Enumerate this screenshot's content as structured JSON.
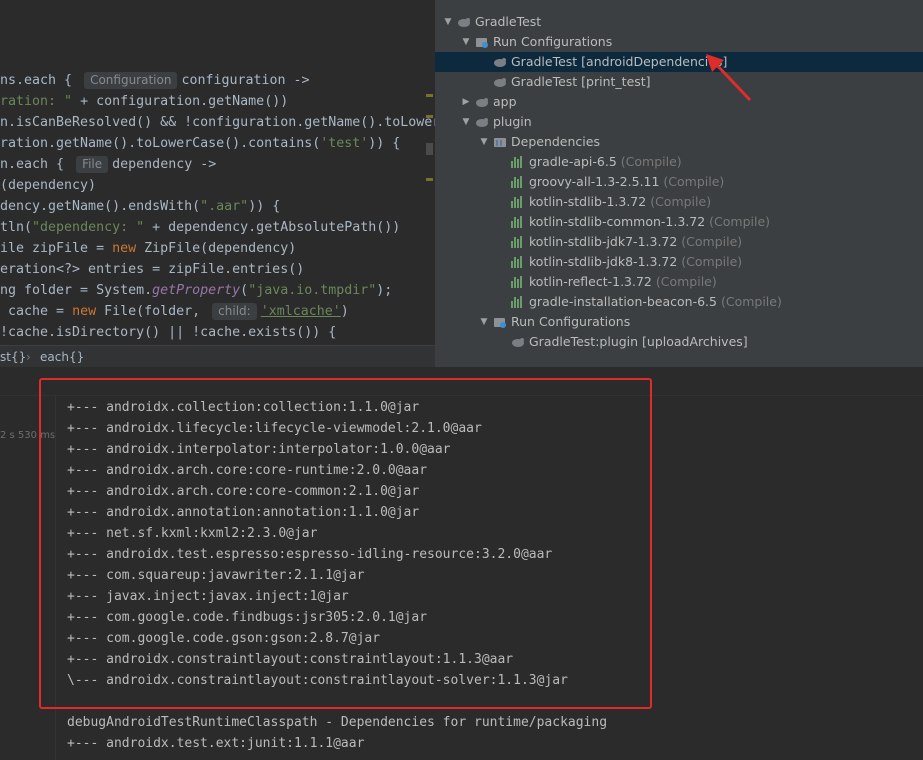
{
  "editor": {
    "lines": [
      {
        "segments": [
          {
            "t": "ns.each { ",
            "c": ""
          },
          {
            "t": "Configuration",
            "c": "hint"
          },
          {
            "t": "configuration ->",
            "c": ""
          }
        ]
      },
      {
        "segments": [
          {
            "t": "ration: \"",
            "c": "str"
          },
          {
            "t": " + configuration.getName())",
            "c": ""
          }
        ]
      },
      {
        "segments": [
          {
            "t": "n.isCanBeResolved() && !configuration.getName().toLower",
            "c": ""
          }
        ]
      },
      {
        "segments": [
          {
            "t": "ration.getName().toLowerCase().contains(",
            "c": ""
          },
          {
            "t": "'test'",
            "c": "str"
          },
          {
            "t": ")) {",
            "c": ""
          }
        ]
      },
      {
        "segments": [
          {
            "t": "n.each { ",
            "c": ""
          },
          {
            "t": "File",
            "c": "hint"
          },
          {
            "t": "dependency ->",
            "c": ""
          }
        ]
      },
      {
        "segments": [
          {
            "t": "(dependency)",
            "c": ""
          }
        ]
      },
      {
        "segments": [
          {
            "t": "dency.getName().endsWith(",
            "c": ""
          },
          {
            "t": "\".aar\"",
            "c": "str"
          },
          {
            "t": ")) {",
            "c": ""
          }
        ]
      },
      {
        "segments": [
          {
            "t": "tln(",
            "c": ""
          },
          {
            "t": "\"dependency: \"",
            "c": "str"
          },
          {
            "t": " + dependency.getAbsolutePath())",
            "c": ""
          }
        ]
      },
      {
        "segments": [
          {
            "t": "ile zipFile = ",
            "c": ""
          },
          {
            "t": "new",
            "c": "kw"
          },
          {
            "t": " ZipFile(dependency)",
            "c": ""
          }
        ]
      },
      {
        "segments": [
          {
            "t": "eration<?> entries = zipFile.entries()",
            "c": ""
          }
        ]
      },
      {
        "segments": [
          {
            "t": "ng folder = System.",
            "c": ""
          },
          {
            "t": "getProperty",
            "c": "fn"
          },
          {
            "t": "(",
            "c": ""
          },
          {
            "t": "\"java.io.tmpdir\"",
            "c": "str"
          },
          {
            "t": ");",
            "c": ""
          }
        ]
      },
      {
        "segments": [
          {
            "t": " cache = ",
            "c": ""
          },
          {
            "t": "new",
            "c": "kw"
          },
          {
            "t": " File(folder, ",
            "c": ""
          },
          {
            "t": "child:",
            "c": "hint"
          },
          {
            "t": "'xmlcache'",
            "c": "ustr"
          },
          {
            "t": ")",
            "c": ""
          }
        ]
      },
      {
        "segments": [
          {
            "t": "!cache.isDirectory() || !cache.exists()) {",
            "c": ""
          }
        ]
      }
    ]
  },
  "breadcrumb": {
    "item1": "st{}",
    "sep": "›",
    "item2": "each{}"
  },
  "gradle_tree": {
    "rows": [
      {
        "label": "GradleTest",
        "suffix": "",
        "indent": 0,
        "arrow": "▼",
        "icon": "gradle-elephant-icon",
        "selected": false
      },
      {
        "label": "Run Configurations",
        "suffix": "",
        "indent": 1,
        "arrow": "▼",
        "icon": "run-configurations-icon",
        "selected": false
      },
      {
        "label": "GradleTest [androidDependencies]",
        "suffix": "",
        "indent": 2,
        "arrow": "",
        "icon": "gradle-task-icon",
        "selected": true
      },
      {
        "label": "GradleTest [print_test]",
        "suffix": "",
        "indent": 2,
        "arrow": "",
        "icon": "gradle-task-icon",
        "selected": false
      },
      {
        "label": "app",
        "suffix": "",
        "indent": 1,
        "arrow": "▶",
        "icon": "gradle-elephant-icon",
        "selected": false
      },
      {
        "label": "plugin",
        "suffix": "",
        "indent": 1,
        "arrow": "▼",
        "icon": "gradle-elephant-icon",
        "selected": false
      },
      {
        "label": "Dependencies",
        "suffix": "",
        "indent": 2,
        "arrow": "▼",
        "icon": "dependencies-folder-icon",
        "selected": false
      },
      {
        "label": "gradle-api-6.5",
        "suffix": " (Compile)",
        "indent": 3,
        "arrow": "",
        "icon": "library-icon",
        "selected": false
      },
      {
        "label": "groovy-all-1.3-2.5.11",
        "suffix": " (Compile)",
        "indent": 3,
        "arrow": "",
        "icon": "library-icon",
        "selected": false
      },
      {
        "label": "kotlin-stdlib-1.3.72",
        "suffix": " (Compile)",
        "indent": 3,
        "arrow": "",
        "icon": "library-icon",
        "selected": false
      },
      {
        "label": "kotlin-stdlib-common-1.3.72",
        "suffix": " (Compile)",
        "indent": 3,
        "arrow": "",
        "icon": "library-icon",
        "selected": false
      },
      {
        "label": "kotlin-stdlib-jdk7-1.3.72",
        "suffix": " (Compile)",
        "indent": 3,
        "arrow": "",
        "icon": "library-icon",
        "selected": false
      },
      {
        "label": "kotlin-stdlib-jdk8-1.3.72",
        "suffix": " (Compile)",
        "indent": 3,
        "arrow": "",
        "icon": "library-icon",
        "selected": false
      },
      {
        "label": "kotlin-reflect-1.3.72",
        "suffix": " (Compile)",
        "indent": 3,
        "arrow": "",
        "icon": "library-icon",
        "selected": false
      },
      {
        "label": "gradle-installation-beacon-6.5",
        "suffix": " (Compile)",
        "indent": 3,
        "arrow": "",
        "icon": "library-icon",
        "selected": false
      },
      {
        "label": "Run Configurations",
        "suffix": "",
        "indent": 2,
        "arrow": "▼",
        "icon": "run-configurations-icon",
        "selected": false
      },
      {
        "label": "GradleTest:plugin [uploadArchives]",
        "suffix": "",
        "indent": 3,
        "arrow": "",
        "icon": "gradle-task-icon",
        "selected": false
      }
    ]
  },
  "console": {
    "timing": "2 s 530 ms",
    "lines": [
      "+--- androidx.collection:collection:1.1.0@jar",
      "+--- androidx.lifecycle:lifecycle-viewmodel:2.1.0@aar",
      "+--- androidx.interpolator:interpolator:1.0.0@aar",
      "+--- androidx.arch.core:core-runtime:2.0.0@aar",
      "+--- androidx.arch.core:core-common:2.1.0@jar",
      "+--- androidx.annotation:annotation:1.1.0@jar",
      "+--- net.sf.kxml:kxml2:2.3.0@jar",
      "+--- androidx.test.espresso:espresso-idling-resource:3.2.0@aar",
      "+--- com.squareup:javawriter:2.1.1@jar",
      "+--- javax.inject:javax.inject:1@jar",
      "+--- com.google.code.findbugs:jsr305:2.0.1@jar",
      "+--- com.google.code.gson:gson:2.8.7@jar",
      "+--- androidx.constraintlayout:constraintlayout:1.1.3@aar",
      "\\--- androidx.constraintlayout:constraintlayout-solver:1.1.3@jar",
      "",
      "debugAndroidTestRuntimeClasspath - Dependencies for runtime/packaging",
      "+--- androidx.test.ext:junit:1.1.1@aar"
    ]
  },
  "colors": {
    "annotation_red": "#e02b2b",
    "selection": "#0d293e"
  }
}
